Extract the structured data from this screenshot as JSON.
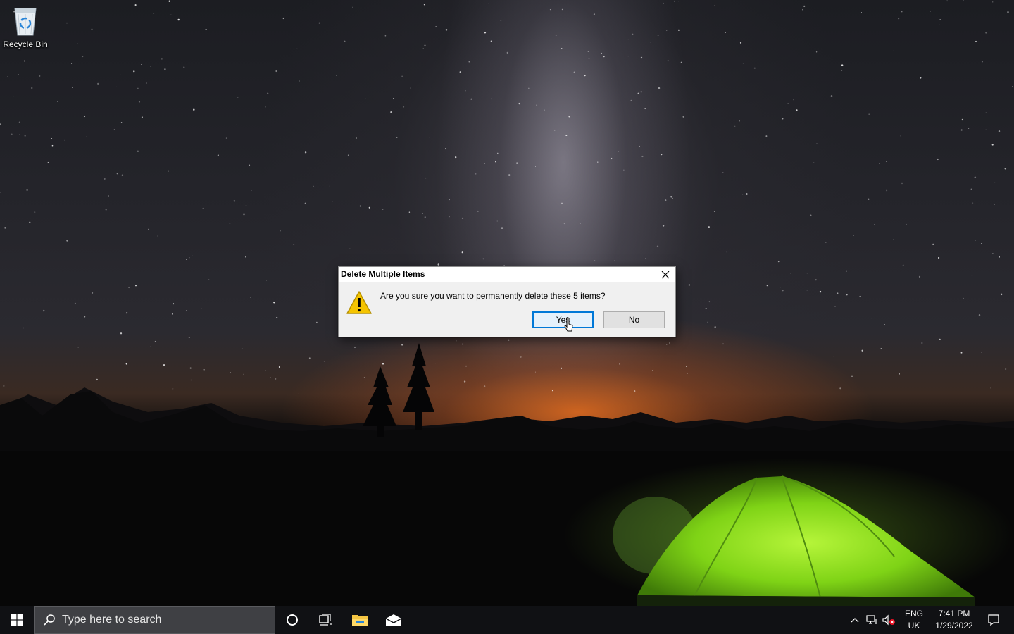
{
  "desktop": {
    "icons": [
      {
        "label": "Recycle Bin",
        "icon": "recycle-bin-icon"
      }
    ]
  },
  "dialog": {
    "title": "Delete Multiple Items",
    "message": "Are you sure you want to permanently delete these 5 items?",
    "icon": "warning-icon",
    "yes_label": "Yes",
    "no_label": "No",
    "close_icon": "close-icon"
  },
  "taskbar": {
    "search_placeholder": "Type here to search",
    "pinned": [
      "cortana-icon",
      "task-view-icon",
      "file-explorer-icon",
      "mail-icon"
    ],
    "tray": {
      "language_line1": "ENG",
      "language_line2": "UK",
      "time": "7:41 PM",
      "date": "1/29/2022",
      "icons": [
        "chevron-up-icon",
        "network-icon",
        "volume-muted-icon",
        "action-center-icon"
      ]
    }
  },
  "colors": {
    "taskbar": "#101114",
    "search_box": "#3f4044",
    "dialog_bg": "#f0f0f0",
    "default_button_border": "#0078d7",
    "warning_yellow": "#f5c400",
    "tent_green": "#8ee21a"
  }
}
